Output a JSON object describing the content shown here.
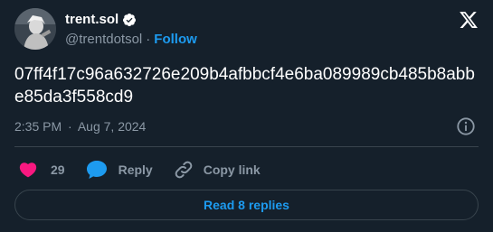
{
  "author": {
    "display_name": "trent.sol",
    "handle": "@trentdotsol",
    "separator": "·",
    "follow_label": "Follow",
    "verified": true
  },
  "tweet": {
    "text": "07ff4f17c96a632726e209b4afbbcf4e6ba089989cb485b8abbe85da3f558cd9",
    "time": "2:35 PM",
    "date_separator": "·",
    "date": "Aug 7, 2024"
  },
  "actions": {
    "like_count": "29",
    "reply_label": "Reply",
    "copy_link_label": "Copy link"
  },
  "footer": {
    "read_replies_label": "Read 8 replies"
  },
  "colors": {
    "background": "#15202b",
    "accent": "#1d9bf0",
    "like": "#f91880",
    "muted": "#8b98a5",
    "border": "#38444d"
  },
  "icons": {
    "verified": "verified-badge-icon",
    "brand": "x-logo-icon",
    "info": "info-icon",
    "like": "heart-icon",
    "reply": "speech-bubble-icon",
    "copy": "link-icon"
  }
}
